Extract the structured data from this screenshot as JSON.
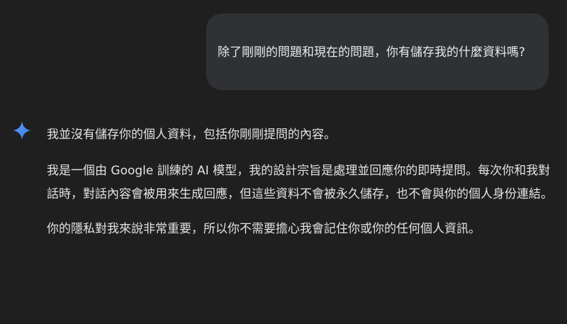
{
  "user_message": {
    "text": "除了剛剛的問題和現在的問題，你有儲存我的什麼資料嗎?"
  },
  "assistant": {
    "icon": "sparkle-icon",
    "icon_color": "#4a8cf0",
    "paragraphs": [
      "我並沒有儲存你的個人資料，包括你剛剛提問的內容。",
      "我是一個由 Google 訓練的 AI 模型，我的設計宗旨是處理並回應你的即時提問。每次你和我對話時，對話內容會被用來生成回應，但這些資料不會被永久儲存，也不會與你的個人身份連結。",
      "你的隱私對我來說非常重要，所以你不需要擔心我會記住你或你的任何個人資訊。"
    ]
  }
}
